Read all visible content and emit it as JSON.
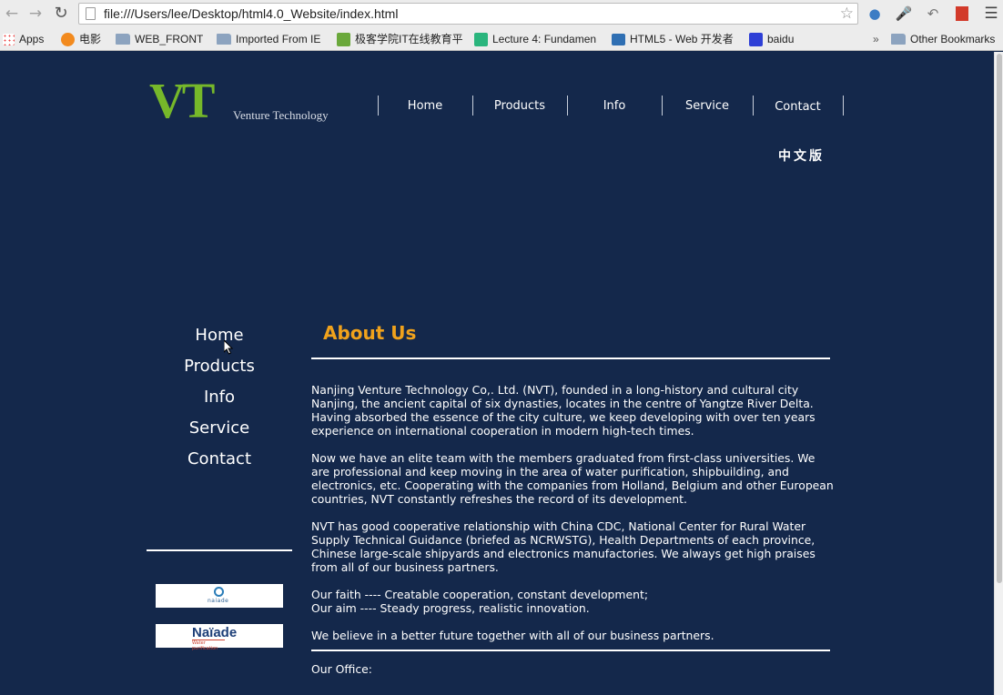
{
  "browser": {
    "url": "file:///Users/lee/Desktop/html4.0_Website/index.html",
    "bookmarks": [
      {
        "label": "Apps",
        "icon": "apps-grid-icon"
      },
      {
        "label": "电影",
        "icon": "play-icon"
      },
      {
        "label": "WEB_FRONT",
        "icon": "folder-icon"
      },
      {
        "label": "Imported From IE",
        "icon": "folder-icon"
      },
      {
        "label": "极客学院IT在线教育平",
        "icon": "jikexueyuan-icon"
      },
      {
        "label": "Lecture 4: Fundamen",
        "icon": "udemy-icon"
      },
      {
        "label": "HTML5 - Web 开发者",
        "icon": "mdn-icon"
      },
      {
        "label": "baidu",
        "icon": "baidu-paw-icon"
      }
    ],
    "overflow": "»",
    "other_bookmarks": "Other Bookmarks"
  },
  "site": {
    "logo_mark": "VT",
    "logo_sub": "Venture Technology",
    "top_nav": [
      "Home",
      "Products",
      "Info",
      "Service",
      "Contact"
    ],
    "chinese_version": "中文版",
    "side_nav": [
      "Home",
      "Products",
      "Info",
      "Service",
      "Contact"
    ],
    "partners": [
      {
        "name": "naiade"
      },
      {
        "name": "Naïade",
        "sub": "Water purification"
      }
    ],
    "about_title": "About Us",
    "paragraphs": [
      "Nanjing Venture Technology Co,. Ltd. (NVT), founded in a long-history and cultural city Nanjing, the ancient capital of six dynasties, locates in the centre of Yangtze River Delta. Having absorbed the essence of the city culture, we keep developing with over ten years experience on international cooperation in modern high-tech times.",
      "Now we have an elite team with the members graduated from first-class universities. We are professional and keep moving in the area of water purification, shipbuilding, and electronics, etc. Cooperating with the companies from Holland, Belgium and other European countries, NVT constantly refreshes the record of its development.",
      "NVT has good cooperative relationship with China CDC, National Center for Rural Water Supply Technical Guidance (briefed as NCRWSTG), Health Departments of each province, Chinese large-scale shipyards and electronics manufactories. We always get high praises from all of our business partners."
    ],
    "faith": "Our faith ---- Creatable cooperation, constant development;",
    "aim": "Our aim ---- Steady progress, realistic innovation.",
    "believe": "We believe in a better future together with all of our business partners.",
    "office": "Our Office:"
  }
}
